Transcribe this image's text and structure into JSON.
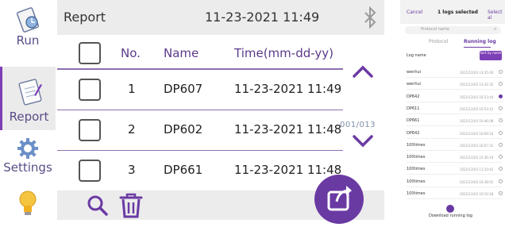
{
  "sidebar": {
    "items": [
      {
        "label": "Run",
        "icon": "run-icon"
      },
      {
        "label": "Report",
        "icon": "report-icon"
      },
      {
        "label": "Settings",
        "icon": "gear-icon"
      },
      {
        "label": "",
        "icon": "lightbulb-icon"
      }
    ]
  },
  "header": {
    "title": "Report",
    "datetime": "11-23-2021 11:49",
    "icon": "bluetooth-icon"
  },
  "table": {
    "columns": [
      "No.",
      "Name",
      "Time(mm-dd-yy)"
    ],
    "rows": [
      {
        "no": "1",
        "name": "DP607",
        "time": "11-23-2021 11:49"
      },
      {
        "no": "2",
        "name": "DP602",
        "time": "11-23-2021 11:48"
      },
      {
        "no": "3",
        "name": "DP661",
        "time": "11-23-2021 11:48"
      }
    ]
  },
  "pager": "001/013",
  "bottom": {
    "search_icon": "search-icon",
    "delete_icon": "trash-icon",
    "share_icon": "share-icon"
  },
  "colors": {
    "accent": "#6a3aa3",
    "bar": "#ececec",
    "divider": "#8d6fb0"
  },
  "phone": {
    "cancel": "Cancel",
    "selected": "1 logs selected",
    "select_all": "Select al",
    "search_placeholder": "Protocol name",
    "tabs": [
      "Protocol",
      "Running log"
    ],
    "list_header": "Log name",
    "sort_label": "Sort by name",
    "rows": [
      {
        "name": "wenhui",
        "date": "2021/12/03 13:35:40",
        "selected": false
      },
      {
        "name": "wenhui",
        "date": "2021/12/03 13:32:35",
        "selected": false
      },
      {
        "name": "DP642",
        "date": "2021/12/03 10:13:44",
        "selected": true
      },
      {
        "name": "DP611",
        "date": "2021/12/03 10:53:12",
        "selected": false
      },
      {
        "name": "DP661",
        "date": "2021/12/03 10:46:08",
        "selected": false
      },
      {
        "name": "DP642",
        "date": "2021/12/03 10:09:24",
        "selected": false
      },
      {
        "name": "100times",
        "date": "2021/12/03 16:07:31",
        "selected": false
      },
      {
        "name": "100times",
        "date": "2021/12/03 15:36:19",
        "selected": false
      },
      {
        "name": "100times",
        "date": "2021/12/03 11:10:42",
        "selected": false
      },
      {
        "name": "100times",
        "date": "2021/12/03 10:38:01",
        "selected": false
      },
      {
        "name": "100times",
        "date": "2021/12/03 10:10:18",
        "selected": false
      }
    ],
    "download_label": "Download running log"
  }
}
